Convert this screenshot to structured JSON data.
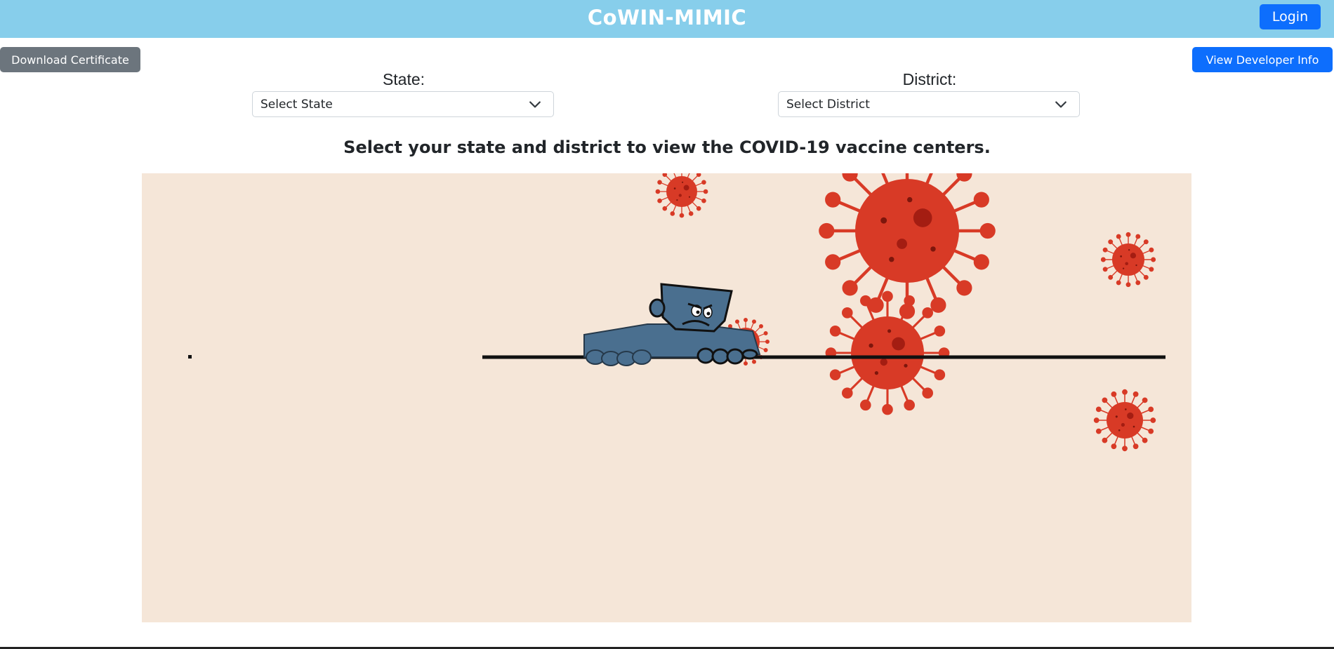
{
  "header": {
    "title": "CoWIN-MIMIC",
    "login_label": "Login"
  },
  "toolbar": {
    "download_label": "Download Certificate",
    "developer_label": "View Developer Info"
  },
  "filters": {
    "state_label": "State:",
    "state_placeholder": "Select State",
    "district_label": "District:",
    "district_placeholder": "Select District"
  },
  "main": {
    "prompt": "Select your state and district to view the COVID-19 vaccine centers."
  },
  "colors": {
    "navbar": "#87ceeb",
    "primary": "#0d6efd",
    "secondary": "#6c757d",
    "illustration_bg": "#f5e6d8",
    "virus": "#d83a26",
    "figure": "#4a6f8f"
  },
  "icons": {
    "select_chevron": "chevron-down-icon",
    "illustration": "virus-illustration"
  }
}
